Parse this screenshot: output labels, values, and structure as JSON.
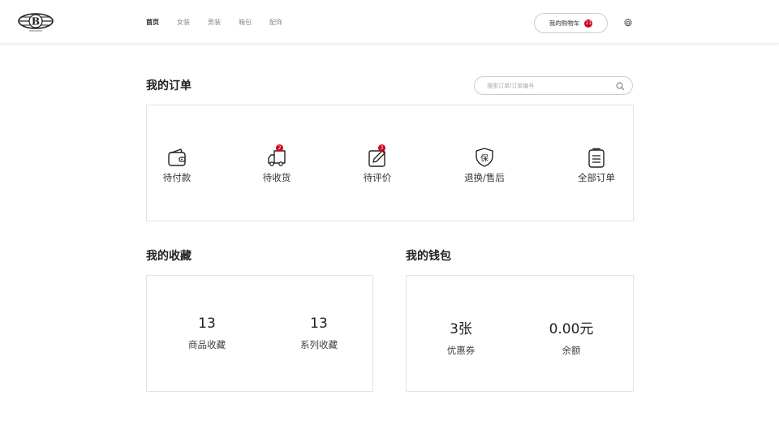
{
  "header": {
    "logo_icon": "brand-logo-icon",
    "nav": [
      {
        "label": "首页",
        "active": true
      },
      {
        "label": "女装",
        "active": false
      },
      {
        "label": "男装",
        "active": false
      },
      {
        "label": "箱包",
        "active": false
      },
      {
        "label": "配饰",
        "active": false
      }
    ],
    "cart_label": "我的购物车",
    "cart_count": "11",
    "settings_icon": "gear-icon"
  },
  "orders": {
    "title": "我的订单",
    "search_placeholder": "搜索订单/订单编号",
    "items": [
      {
        "label": "待付款",
        "icon": "wallet-icon",
        "badge": ""
      },
      {
        "label": "待收货",
        "icon": "truck-icon",
        "badge": "2"
      },
      {
        "label": "待评价",
        "icon": "edit-icon",
        "badge": "3"
      },
      {
        "label": "退换/售后",
        "icon": "shield-icon",
        "badge": ""
      },
      {
        "label": "全部订单",
        "icon": "clipboard-icon",
        "badge": ""
      }
    ]
  },
  "favorites": {
    "title": "我的收藏",
    "items": [
      {
        "value": "13",
        "label": "商品收藏"
      },
      {
        "value": "13",
        "label": "系列收藏"
      }
    ]
  },
  "wallet": {
    "title": "我的钱包",
    "items": [
      {
        "value": "3张",
        "label": "优惠券"
      },
      {
        "value": "0.00元",
        "label": "余额"
      }
    ]
  },
  "colors": {
    "accent": "#d0021b",
    "border": "#e3e3e3",
    "text": "#222222"
  }
}
